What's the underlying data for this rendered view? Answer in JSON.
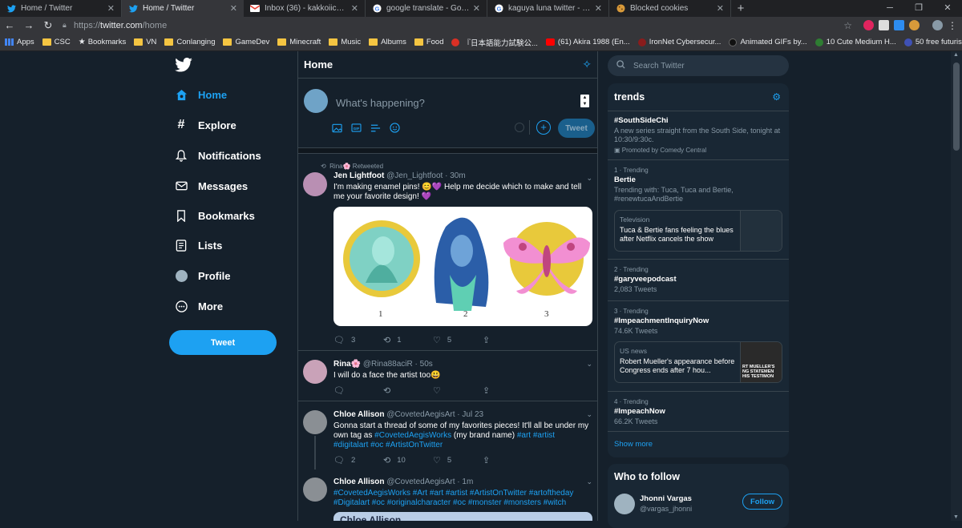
{
  "browser": {
    "tabs": [
      {
        "title": "Home / Twitter",
        "icon": "twitter-icon",
        "active": false
      },
      {
        "title": "Home / Twitter",
        "icon": "twitter-icon",
        "active": true
      },
      {
        "title": "Inbox (36) - kakkoiichris@gmail.c",
        "icon": "gmail-icon",
        "active": false
      },
      {
        "title": "google translate - Google Search",
        "icon": "google-icon",
        "active": false
      },
      {
        "title": "kaguya luna twitter - Google Sea",
        "icon": "google-icon",
        "active": false
      },
      {
        "title": "Blocked cookies",
        "icon": "cookie-icon",
        "active": false
      }
    ],
    "url_prefix": "https://",
    "url_host": "twitter.com",
    "url_path": "/home",
    "bookmarks": [
      {
        "label": "Apps",
        "kind": "apps"
      },
      {
        "label": "CSC",
        "kind": "folder"
      },
      {
        "label": "Bookmarks",
        "kind": "star"
      },
      {
        "label": "VN",
        "kind": "folder"
      },
      {
        "label": "Conlanging",
        "kind": "folder"
      },
      {
        "label": "GameDev",
        "kind": "folder"
      },
      {
        "label": "Minecraft",
        "kind": "folder"
      },
      {
        "label": "Music",
        "kind": "folder"
      },
      {
        "label": "Albums",
        "kind": "folder"
      },
      {
        "label": "Food",
        "kind": "folder"
      },
      {
        "label": "『日本語能力試験公...",
        "kind": "site"
      },
      {
        "label": "(61) Akira 1988 (En...",
        "kind": "youtube"
      },
      {
        "label": "IronNet Cybersecur...",
        "kind": "site"
      },
      {
        "label": "Animated GIFs by...",
        "kind": "site"
      },
      {
        "label": "10 Cute Medium H...",
        "kind": "site"
      },
      {
        "label": "50 free futuristic fo...",
        "kind": "site"
      }
    ]
  },
  "nav": {
    "items": [
      {
        "label": "Home",
        "icon": "home-icon",
        "active": true
      },
      {
        "label": "Explore",
        "icon": "hashtag-icon",
        "active": false
      },
      {
        "label": "Notifications",
        "icon": "bell-icon",
        "active": false
      },
      {
        "label": "Messages",
        "icon": "envelope-icon",
        "active": false
      },
      {
        "label": "Bookmarks",
        "icon": "bookmark-icon",
        "active": false
      },
      {
        "label": "Lists",
        "icon": "list-icon",
        "active": false
      },
      {
        "label": "Profile",
        "icon": "avatar-icon",
        "active": false
      },
      {
        "label": "More",
        "icon": "more-icon",
        "active": false
      }
    ],
    "tweet_button": "Tweet"
  },
  "feed": {
    "title": "Home",
    "composer": {
      "placeholder": "What's happening?",
      "tweet_button": "Tweet"
    },
    "tweets": [
      {
        "retweeted_by": "Rina🌸 Retweeted",
        "name": "Jen Lightfoot",
        "handle": "@Jen_Lightfoot",
        "time": "· 30m",
        "text": "I'm making enamel pins! 😊💜 Help me decide which to make and tell me your favorite design! 💜",
        "media_labels": [
          "1",
          "2",
          "3"
        ],
        "replies": "3",
        "retweets": "1",
        "likes": "5"
      },
      {
        "name": "Rina🌸",
        "handle": "@Rina88aciR",
        "time": "· 50s",
        "text": "I will do a face the artist too😃",
        "replies": "",
        "retweets": "",
        "likes": ""
      },
      {
        "name": "Chloe Allison",
        "handle": "@CovetedAegisArt",
        "time": "· Jul 23",
        "text_plain": "Gonna start a thread of some of my favorites pieces! It'll all be under my own tag as ",
        "tag1": "#CovetedAegisWorks",
        "text_mid": " (my brand name) ",
        "tags2": "#art #artist #digitalart #oc #ArtistOnTwitter",
        "replies": "2",
        "retweets": "10",
        "likes": "5"
      },
      {
        "name": "Chloe Allison",
        "handle": "@CovetedAegisArt",
        "time": "· 1m",
        "tags": "#CovetedAegisWorks #Art #art #artist #ArtistOnTwitter #artoftheday #Digitalart #oc #originalcharacter #oc #monster #monsters #witch",
        "media_caption": "Chloe Allison"
      }
    ]
  },
  "right": {
    "search_placeholder": "Search Twitter",
    "trends_title": "trends",
    "trends": [
      {
        "meta": "",
        "name": "#SouthSideChi",
        "sub": "A new series straight from the South Side, tonight at 10:30/9:30c.",
        "promo": "Promoted by Comedy Central"
      },
      {
        "meta": "1 · Trending",
        "name": "Bertie",
        "sub": "Trending with: Tuca, Tuca and Bertie, #renewtucaAndBertie",
        "news_cat": "Television",
        "news_headline": "Tuca & Bertie fans feeling the blues after Netflix cancels the show"
      },
      {
        "meta": "2 · Trending",
        "name": "#garyveepodcast",
        "sub": "2,083 Tweets"
      },
      {
        "meta": "3 · Trending",
        "name": "#ImpeachmentInquiryNow",
        "sub": "74.6K Tweets",
        "news_cat": "US news",
        "news_headline": "Robert Mueller's appearance before Congress ends after 7 hou...",
        "thumb_text": "RT MUELLER'S NG STATEMEN HIS TESTIMON"
      },
      {
        "meta": "4 · Trending",
        "name": "#ImpeachNow",
        "sub": "66.2K Tweets"
      }
    ],
    "show_more": "Show more",
    "who_to_follow": {
      "title": "Who to follow",
      "name": "Jhonni Vargas",
      "handle": "@vargas_jhonni",
      "button": "Follow"
    }
  },
  "colors": {
    "accent": "#1da1f2",
    "background": "#15202b",
    "card": "#192734",
    "muted": "#8899a6"
  }
}
